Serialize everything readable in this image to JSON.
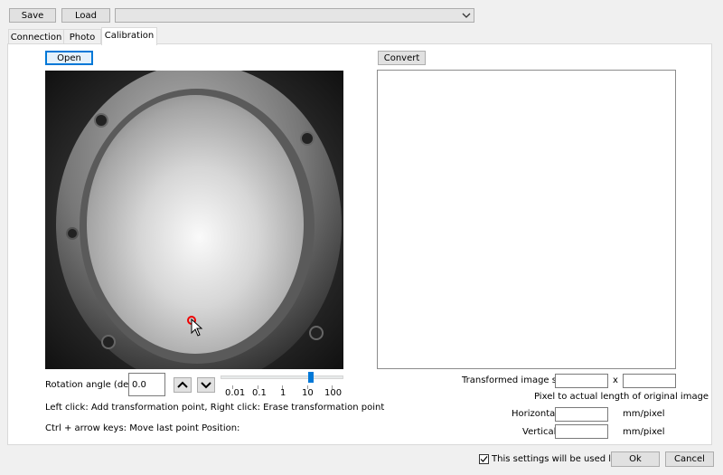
{
  "toolbar": {
    "save_label": "Save",
    "load_label": "Load",
    "combo_value": ""
  },
  "tabs": [
    {
      "label": "Connection"
    },
    {
      "label": "Photo"
    },
    {
      "label": "Calibration"
    }
  ],
  "left": {
    "open_label": "Open",
    "rotation_label": "Rotation angle (deg)",
    "rotation_value": "0.0",
    "slider_ticks": [
      "0.01",
      "0.1",
      "1",
      "10",
      "100"
    ],
    "slider_selected": "10",
    "help_line1": "Left click: Add transformation point, Right click: Erase transformation point",
    "help_line2": "Ctrl + arrow keys: Move last point  Position:"
  },
  "right": {
    "convert_label": "Convert",
    "transformed_size_label": "Transformed image size:",
    "size_x_value": "",
    "size_separator": "x",
    "size_y_value": "",
    "pixel_heading": "Pixel to actual length of original image",
    "horizontal_label": "Horizontal:",
    "horizontal_value": "",
    "horizontal_unit": "mm/pixel",
    "vertical_label": "Vertical:",
    "vertical_value": "",
    "vertical_unit": "mm/pixel"
  },
  "footer": {
    "checkbox_label": "This settings will be used later.",
    "checkbox_checked": true,
    "ok_label": "Ok",
    "cancel_label": "Cancel"
  },
  "icons": [
    "chevron-down-icon",
    "chevron-up-icon",
    "cursor-icon",
    "checkmark-icon"
  ]
}
